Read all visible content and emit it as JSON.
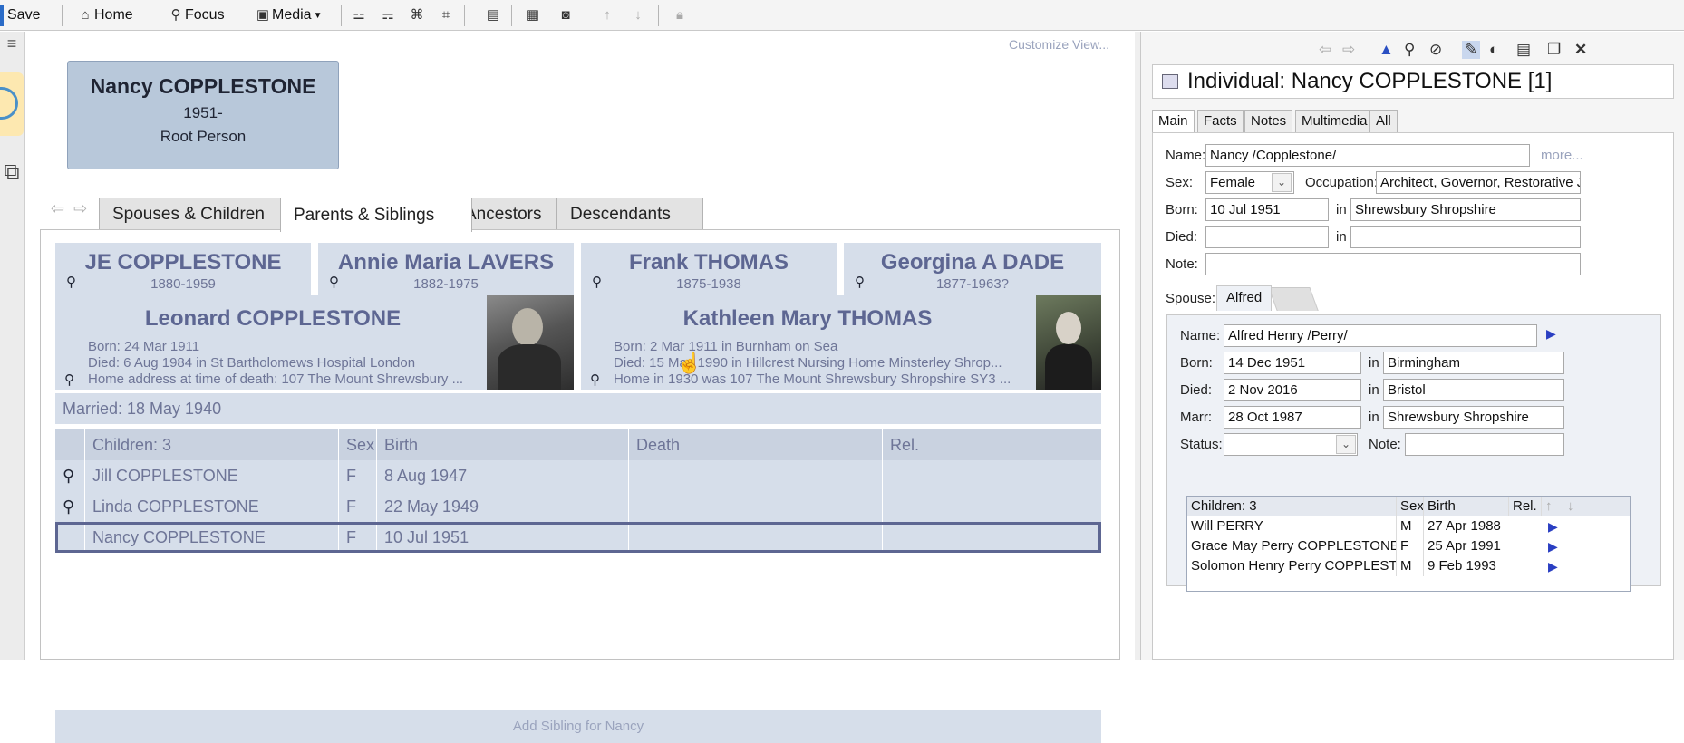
{
  "toolbar": {
    "save": "Save",
    "home": "Home",
    "focus": "Focus",
    "media": "Media"
  },
  "main": {
    "customize": "Customize View...",
    "root": {
      "name": "Nancy COPPLESTONE",
      "years": "1951-",
      "label": "Root Person"
    },
    "tabs": [
      "Spouses & Children",
      "Parents & Siblings",
      "Ancestors",
      "Descendants"
    ],
    "grandparents": [
      {
        "name": "JE COPPLESTONE",
        "years": "1880-1959"
      },
      {
        "name": "Annie Maria LAVERS",
        "years": "1882-1975"
      },
      {
        "name": "Frank THOMAS",
        "years": "1875-1938"
      },
      {
        "name": "Georgina A DADE",
        "years": "1877-1963?"
      }
    ],
    "father": {
      "name": "Leonard COPPLESTONE",
      "born": "Born:   24 Mar 1911",
      "died": "Died:   6 Aug 1984 in St Bartholomews Hospital London",
      "note": "Home address at time of death: 107 The Mount Shrewsbury ..."
    },
    "mother": {
      "name": "Kathleen Mary THOMAS",
      "born": "Born:   2 Mar 1911 in Burnham on Sea",
      "died": "Died:   15 May 1990 in Hillcrest Nursing Home Minsterley Shrop...",
      "note": "Home in 1930 was 107 The Mount Shrewsbury Shropshire SY3 ..."
    },
    "married": "Married: 18 May 1940",
    "children_headers": [
      "Children: 3",
      "Sex",
      "Birth",
      "Death",
      "Rel."
    ],
    "children": [
      {
        "name": "Jill COPPLESTONE",
        "sex": "F",
        "birth": "8 Aug 1947",
        "death": "",
        "rel": ""
      },
      {
        "name": "Linda COPPLESTONE",
        "sex": "F",
        "birth": "22 May 1949",
        "death": "",
        "rel": ""
      },
      {
        "name": "Nancy COPPLESTONE",
        "sex": "F",
        "birth": "10 Jul 1951",
        "death": "",
        "rel": ""
      }
    ],
    "add_sibling": "Add Sibling for Nancy"
  },
  "editor": {
    "title": "Individual: Nancy COPPLESTONE [1]",
    "tabs": [
      "Main",
      "Facts",
      "Notes",
      "Multimedia",
      "All"
    ],
    "labels": {
      "name": "Name:",
      "sex": "Sex:",
      "occupation": "Occupation:",
      "born": "Born:",
      "died": "Died:",
      "in": "in",
      "note": "Note:",
      "spouse": "Spouse:",
      "marr": "Marr:",
      "status": "Status:"
    },
    "more": "more...",
    "name": "Nancy /Copplestone/",
    "sex": "Female",
    "occupation": "Architect, Governor, Restorative Justi",
    "born_date": "10 Jul 1951",
    "born_place": "Shrewsbury Shropshire",
    "died_date": "",
    "died_place": "",
    "note": "",
    "spouse_tab": "Alfred",
    "spouse": {
      "name": "Alfred Henry /Perry/",
      "born_date": "14 Dec 1951",
      "born_place": "Birmingham",
      "died_date": "2 Nov 2016",
      "died_place": "Bristol",
      "marr_date": "28 Oct 1987",
      "marr_place": "Shrewsbury Shropshire",
      "status": "",
      "note": ""
    },
    "kids_headers": [
      "Children: 3",
      "Sex",
      "Birth",
      "Rel."
    ],
    "kids": [
      {
        "name": "Will PERRY",
        "sex": "M",
        "birth": "27 Apr 1988"
      },
      {
        "name": "Grace May Perry COPPLESTONE",
        "sex": "F",
        "birth": "25 Apr 1991"
      },
      {
        "name": "Solomon Henry Perry COPPLESTONE",
        "sex": "M",
        "birth": "9 Feb 1993"
      }
    ]
  }
}
